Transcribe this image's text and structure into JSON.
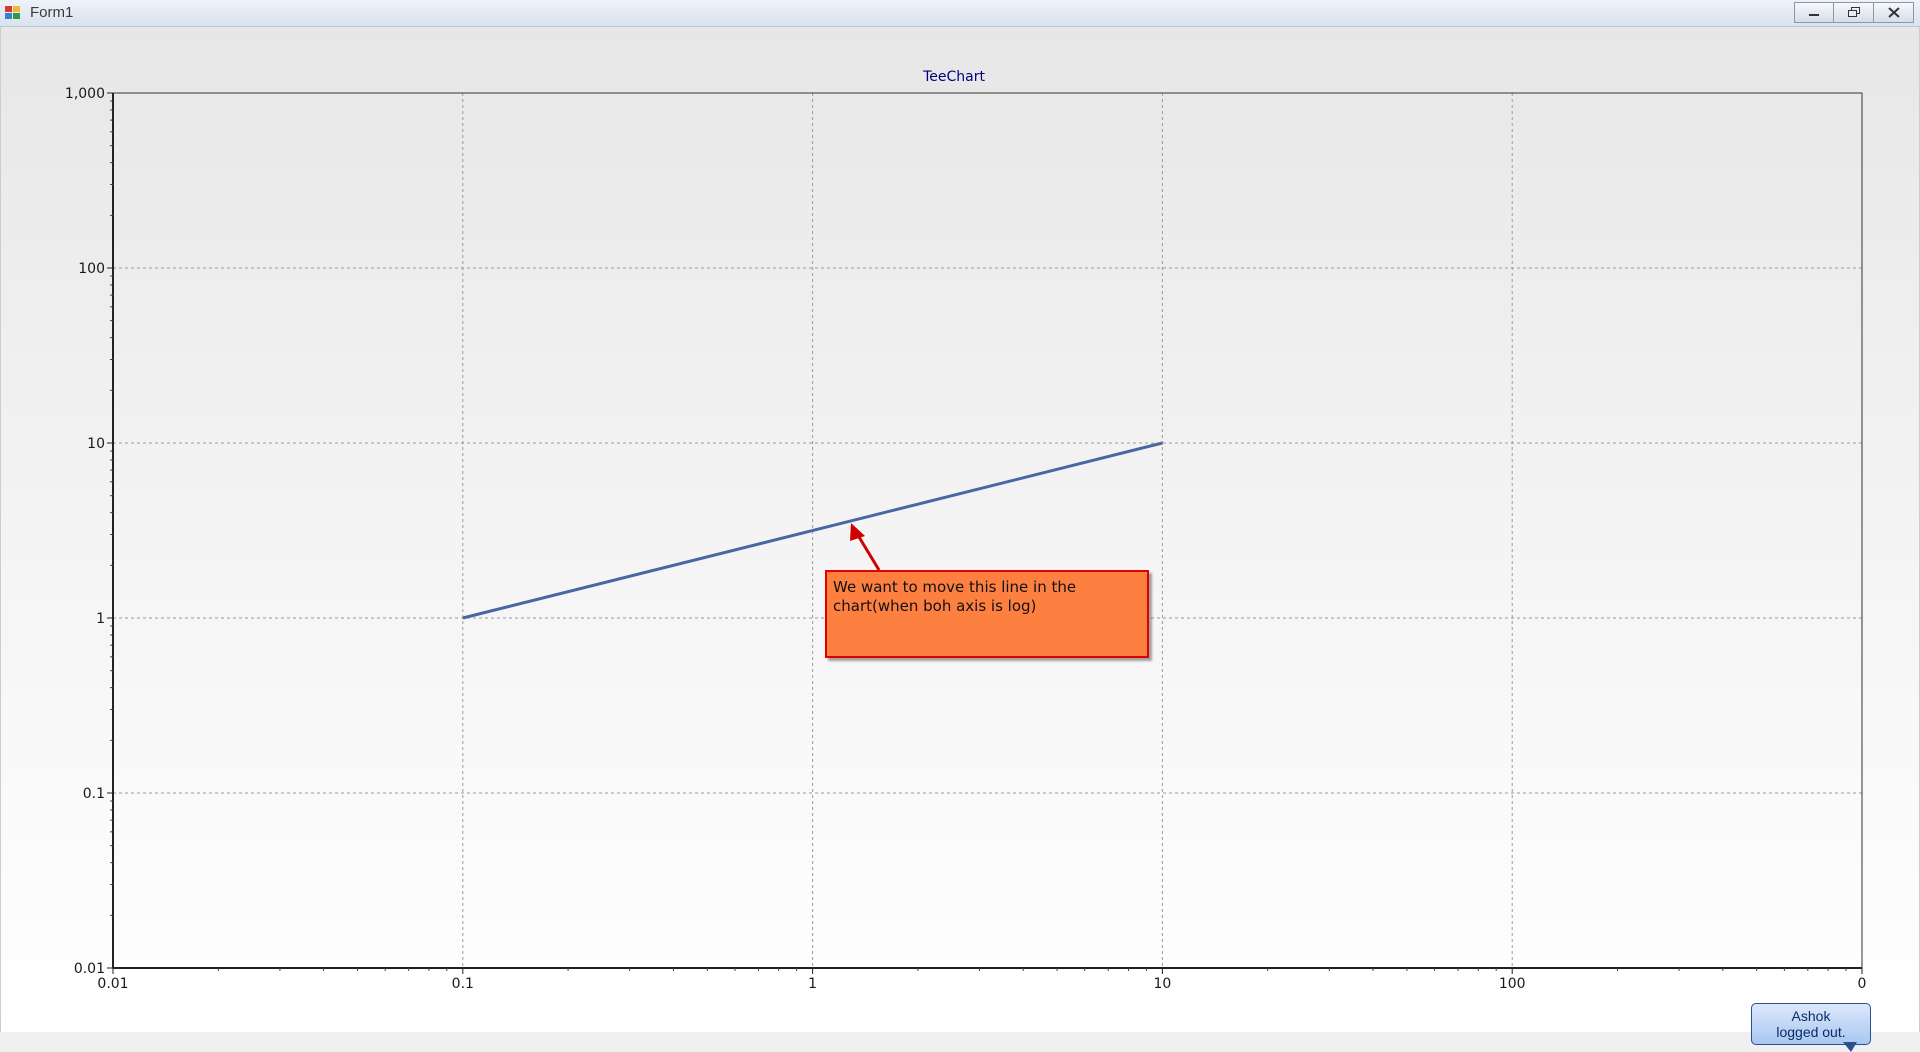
{
  "window": {
    "title": "Form1",
    "buttons": {
      "minimize": "minimize-icon",
      "restore": "restore-icon",
      "close": "close-icon"
    }
  },
  "chart_data": {
    "type": "line",
    "title": "TeeChart",
    "xlabel": "",
    "ylabel": "",
    "x_scale": "log",
    "y_scale": "log",
    "xlim": [
      0.01,
      1000
    ],
    "ylim": [
      0.01,
      1000
    ],
    "x_ticks": [
      "0.01",
      "0.1",
      "1",
      "10",
      "100",
      "0"
    ],
    "y_ticks": [
      "1,000",
      "100",
      "10",
      "1",
      "0.1",
      "0.01"
    ],
    "grid": true,
    "legend": "none",
    "series": [
      {
        "x": [
          0.1,
          10
        ],
        "y": [
          1,
          10
        ],
        "color": "#4a66a0"
      }
    ],
    "annotations": [
      {
        "text": "We want to move this line in the chart(when boh axis is log)",
        "background": "#fe8040",
        "border": "#e00000"
      }
    ]
  },
  "tooltip": {
    "line1": "Ashok",
    "line2": "logged out."
  }
}
